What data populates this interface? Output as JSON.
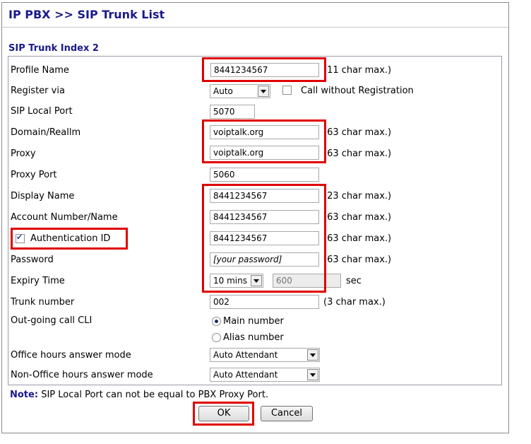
{
  "header": {
    "title": "IP PBX >> SIP Trunk List"
  },
  "section": {
    "title": "SIP Trunk Index 2"
  },
  "fields": {
    "profile_name": {
      "label": "Profile Name",
      "value": "8441234567",
      "hint": "(11 char max.)"
    },
    "register_via": {
      "label": "Register via",
      "value": "Auto",
      "checkbox_label": "Call without Registration"
    },
    "sip_local_port": {
      "label": "SIP Local Port",
      "value": "5070"
    },
    "domain_realm": {
      "label": "Domain/Reallm",
      "value": "voiptalk.org",
      "hint": "(63 char max.)"
    },
    "proxy": {
      "label": "Proxy",
      "value": "voiptalk.org",
      "hint": "(63 char max.)"
    },
    "proxy_port": {
      "label": "Proxy Port",
      "value": "5060"
    },
    "display_name": {
      "label": "Display Name",
      "value": "8441234567",
      "hint": "(23 char max.)"
    },
    "account_number": {
      "label": "Account Number/Name",
      "value": "8441234567",
      "hint": "(63 char max.)"
    },
    "authentication_id": {
      "label": "Authentication ID",
      "value": "8441234567",
      "hint": "(63 char max.)"
    },
    "password": {
      "label": "Password",
      "value": "[your password]",
      "hint": "(63 char max.)"
    },
    "expiry_time": {
      "label": "Expiry Time",
      "select_value": "10 mins",
      "seconds_value": "600",
      "unit": "sec"
    },
    "trunk_number": {
      "label": "Trunk number",
      "value": "002",
      "hint": "(3 char max.)"
    },
    "outgoing_cli": {
      "label": "Out-going call CLI",
      "option_main": "Main number",
      "option_alias": "Alias number"
    },
    "office_hours": {
      "label": "Office hours answer mode",
      "value": "Auto Attendant"
    },
    "non_office_hours": {
      "label": "Non-Office hours answer mode",
      "value": "Auto Attendant"
    }
  },
  "note": {
    "prefix": "Note:",
    "text": "SIP Local Port can not be equal to PBX Proxy Port."
  },
  "buttons": {
    "ok": "OK",
    "cancel": "Cancel"
  },
  "colors": {
    "title": "#1a1a8c",
    "highlight": "#e00000"
  }
}
